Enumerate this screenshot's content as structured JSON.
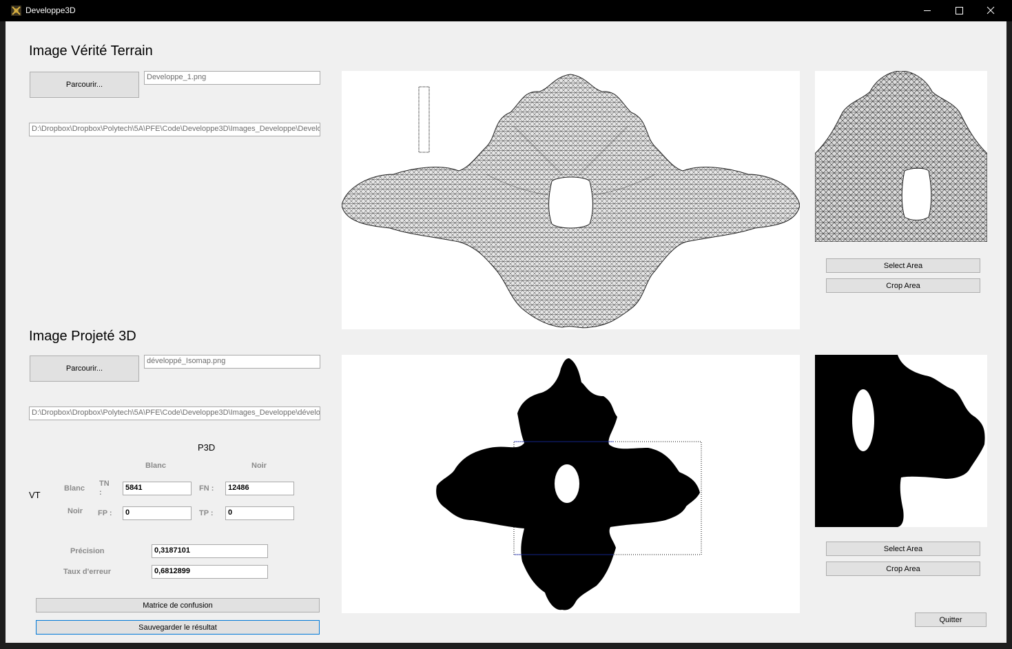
{
  "window": {
    "title": "Developpe3D",
    "minimize_glyph": "—",
    "maximize_glyph": "☐",
    "close_glyph": "✕"
  },
  "vt_section": {
    "heading": "Image Vérité Terrain",
    "browse_label": "Parcourir...",
    "file_name": "Developpe_1.png",
    "file_path": "D:\\Dropbox\\Dropbox\\Polytech\\5A\\PFE\\Code\\Developpe3D\\Images_Developpe\\Developpe_1.png",
    "select_area_label": "Select Area",
    "crop_area_label": "Crop Area"
  },
  "p3d_section": {
    "heading": "Image Projeté 3D",
    "browse_label": "Parcourir...",
    "file_name": "développé_Isomap.png",
    "file_path": "D:\\Dropbox\\Dropbox\\Polytech\\5A\\PFE\\Code\\Developpe3D\\Images_Developpe\\développé_Isomap.png",
    "select_area_label": "Select Area",
    "crop_area_label": "Crop Area"
  },
  "confusion": {
    "col_group": "P3D",
    "row_group": "VT",
    "col_blanc": "Blanc",
    "col_noir": "Noir",
    "row_blanc": "Blanc",
    "row_noir": "Noir",
    "tn_label": "TN :",
    "fn_label": "FN :",
    "fp_label": "FP :",
    "tp_label": "TP :",
    "tn_value": "5841",
    "fn_value": "12486",
    "fp_value": "0",
    "tp_value": "0"
  },
  "metrics": {
    "precision_label": "Précision",
    "precision_value": "0,3187101",
    "error_label": "Taux d'erreur",
    "error_value": "0,6812899"
  },
  "actions": {
    "confusion_button": "Matrice de confusion",
    "save_button": "Sauvegarder le résultat",
    "quit_button": "Quitter"
  },
  "colors": {
    "titlebar": "#000000",
    "client_bg": "#f0f0f0",
    "button_bg": "#e1e1e1",
    "focus_border": "#0078d7"
  }
}
